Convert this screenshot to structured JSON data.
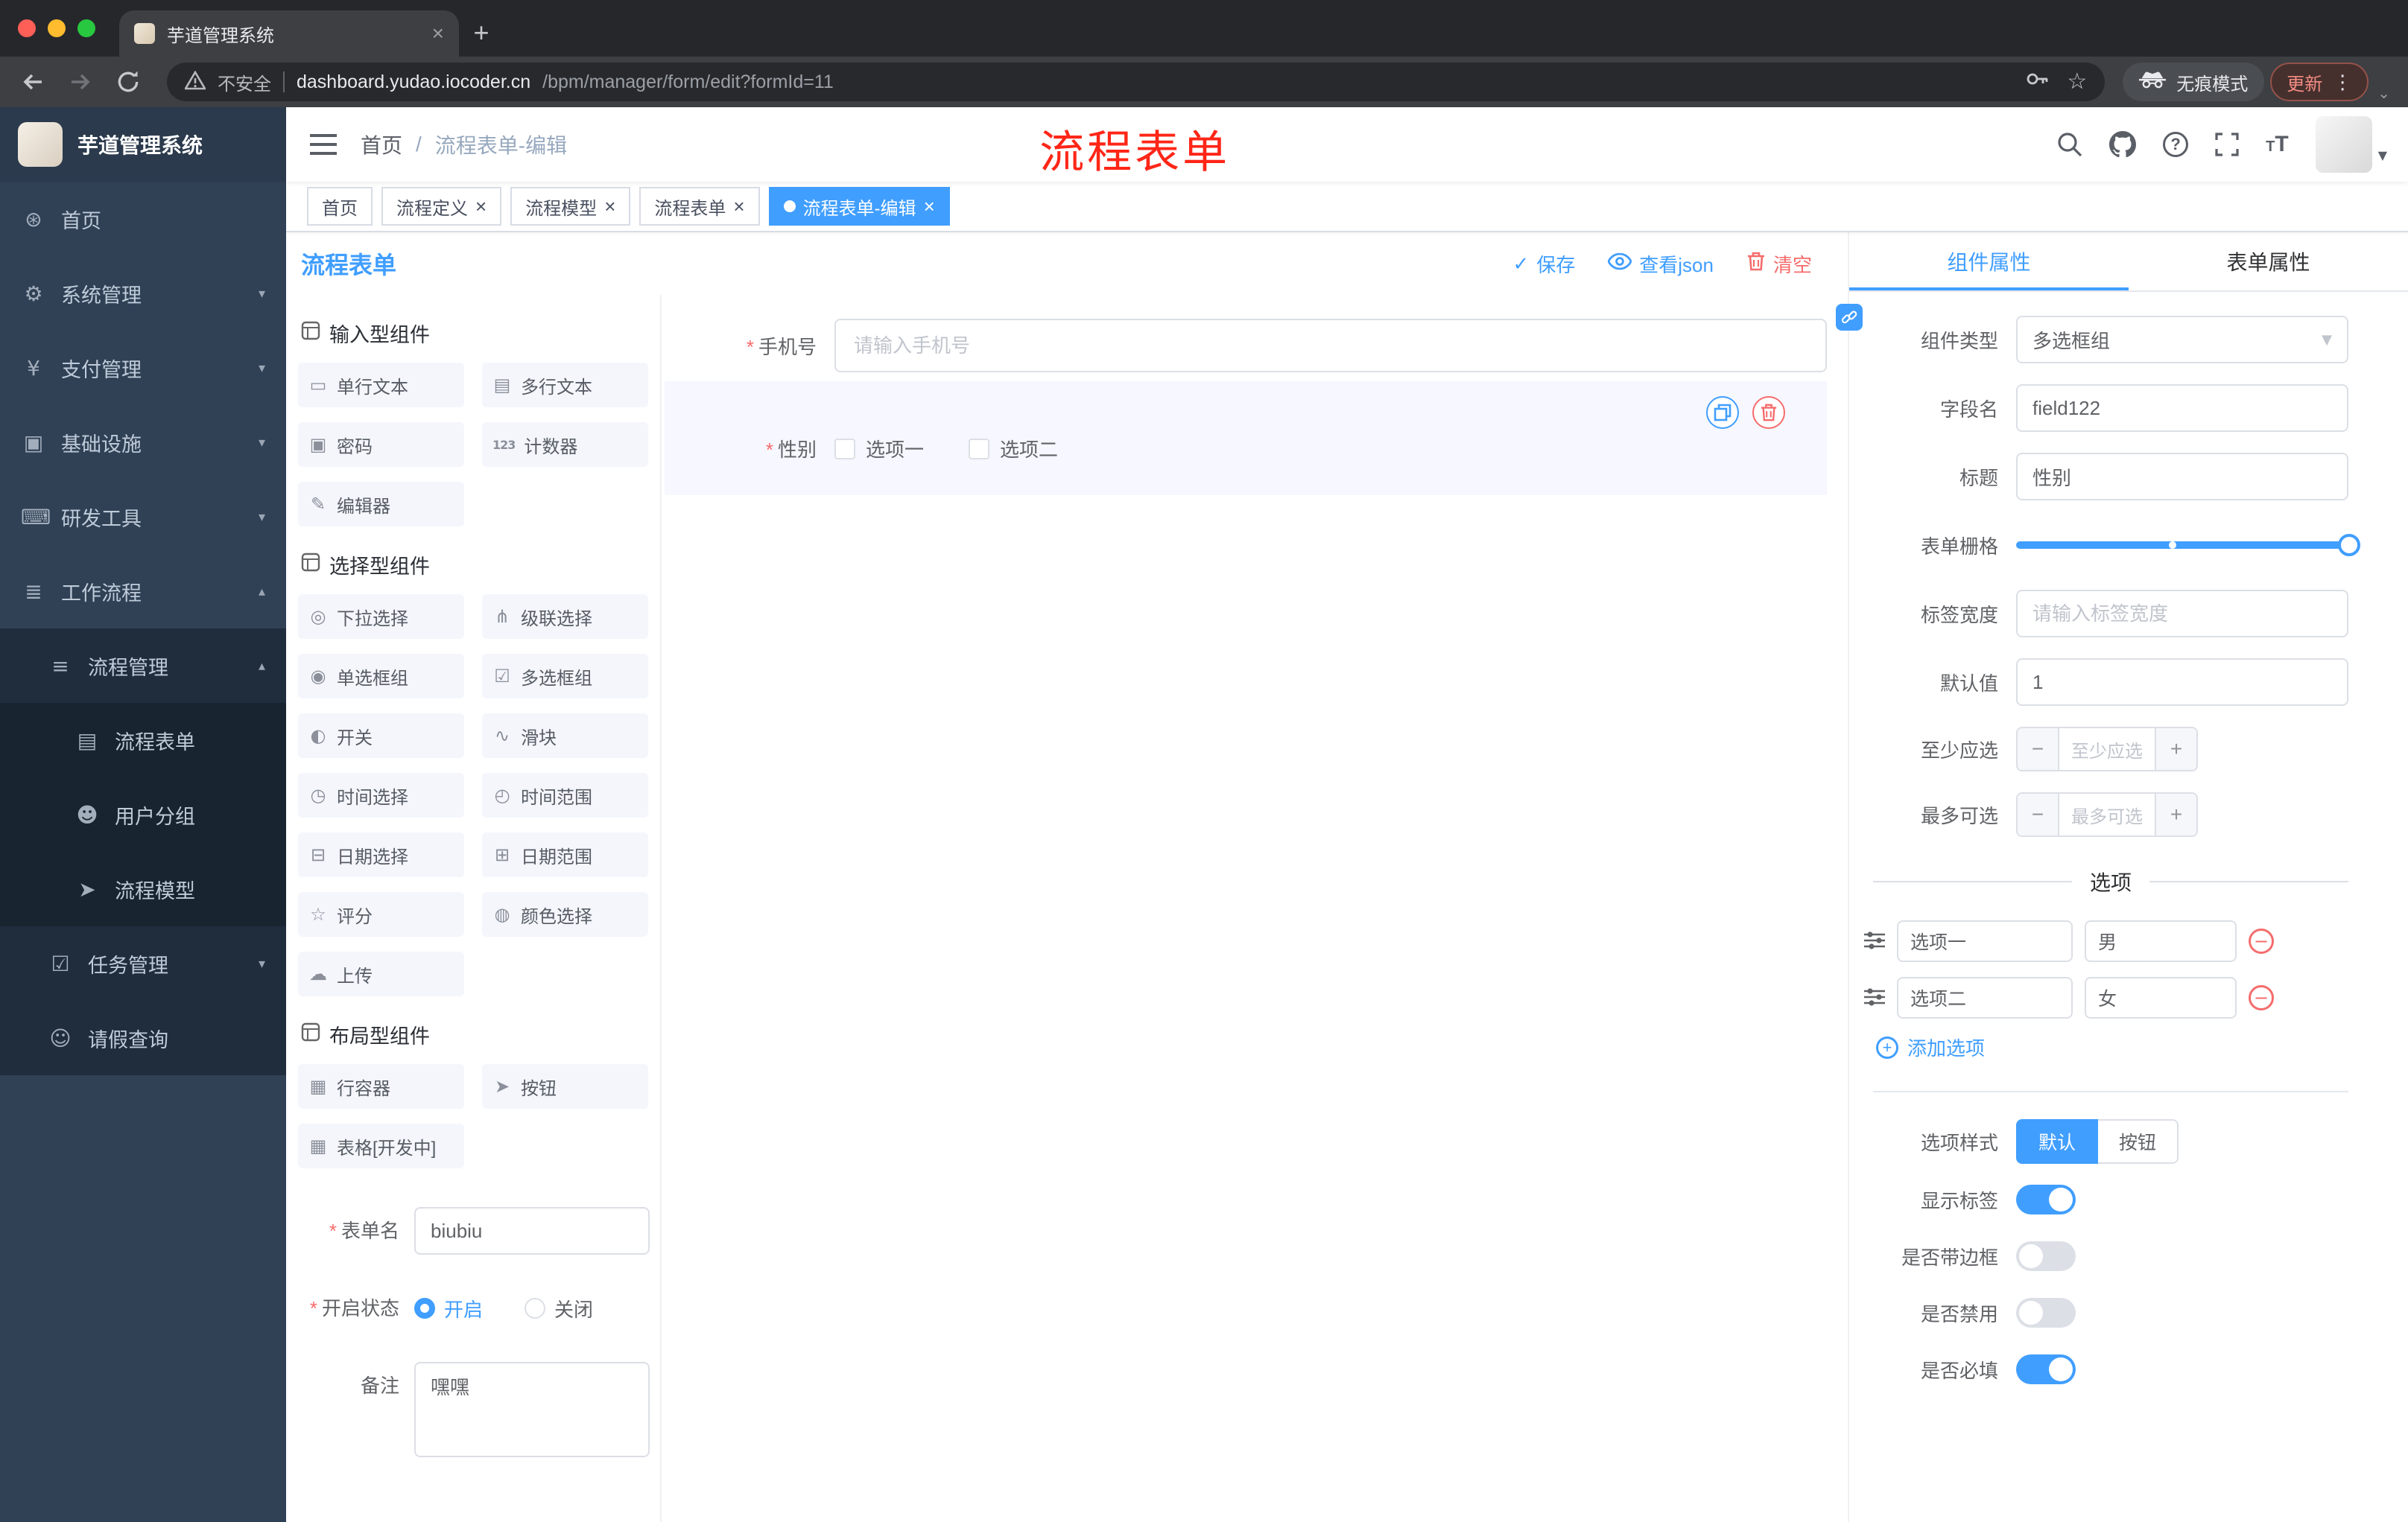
{
  "glyphs": {
    "close": "×",
    "plus": "+",
    "minus": "−",
    "kebab": "⋮",
    "chevron_down": "⌄",
    "caret_down": "▼",
    "select_caret": "▼",
    "check": "✓",
    "breadcrumb_separator": "/",
    "required_mark": "*",
    "bookmark_star": "☆"
  },
  "colors": {
    "primary": "#409eff",
    "danger": "#f56c6c",
    "annotation_red": "#ff2617",
    "sidebar_bg": "#304156",
    "active_tag_bg": "#409eff"
  },
  "browser": {
    "tab": {
      "title": "芋道管理系统"
    },
    "address": {
      "security_label": "不安全",
      "domain": "dashboard.yudao.iocoder.cn",
      "path": "/bpm/manager/form/edit?formId=11"
    },
    "incognito_label": "无痕模式",
    "update_label": "更新"
  },
  "annotation": {
    "text": "流程表单"
  },
  "sidebar": {
    "logo_title": "芋道管理系统",
    "items": [
      {
        "label": "首页",
        "icon": "home-icon",
        "glyph": "⊛"
      },
      {
        "label": "系统管理",
        "icon": "gear-icon",
        "glyph": "⚙",
        "arrow": "▾"
      },
      {
        "label": "支付管理",
        "icon": "payment-icon",
        "glyph": "¥",
        "arrow": "▾"
      },
      {
        "label": "基础设施",
        "icon": "infrastructure-icon",
        "glyph": "▣",
        "arrow": "▾"
      },
      {
        "label": "研发工具",
        "icon": "devtools-icon",
        "glyph": "⌨",
        "arrow": "▾"
      },
      {
        "label": "工作流程",
        "icon": "workflow-icon",
        "glyph": "≣",
        "arrow": "▴",
        "expanded": true
      },
      {
        "label": "流程管理",
        "icon": "process-management-icon",
        "glyph": "≡",
        "arrow": "▴",
        "expanded": true
      },
      {
        "label": "流程表单",
        "icon": "process-form-icon",
        "glyph": "▤",
        "active": true
      },
      {
        "label": "用户分组",
        "icon": "user-group-icon",
        "glyph": "☻"
      },
      {
        "label": "流程模型",
        "icon": "process-model-icon",
        "glyph": "➤"
      },
      {
        "label": "任务管理",
        "icon": "task-management-icon",
        "glyph": "☑",
        "arrow": "▾"
      },
      {
        "label": "请假查询",
        "icon": "leave-query-icon",
        "glyph": "☺"
      }
    ]
  },
  "navbar": {
    "breadcrumb": {
      "home": "首页",
      "separator": "/",
      "current": "流程表单-编辑"
    }
  },
  "tags": {
    "items": [
      {
        "label": "首页",
        "closable": false,
        "active": false
      },
      {
        "label": "流程定义",
        "closable": true,
        "active": false
      },
      {
        "label": "流程模型",
        "closable": true,
        "active": false
      },
      {
        "label": "流程表单",
        "closable": true,
        "active": false
      },
      {
        "label": "流程表单-编辑",
        "closable": true,
        "active": true
      }
    ]
  },
  "designer": {
    "title": "流程表单",
    "actions": {
      "save": "保存",
      "view_json": "查看json",
      "clear": "清空"
    }
  },
  "palette": {
    "sections": [
      {
        "title": "输入型组件",
        "items": [
          {
            "label": "单行文本",
            "icon": "single-line-text-icon",
            "glyph": "▭"
          },
          {
            "label": "多行文本",
            "icon": "multi-line-text-icon",
            "glyph": "▤"
          },
          {
            "label": "密码",
            "icon": "password-icon",
            "glyph": "▣"
          },
          {
            "label": "计数器",
            "icon": "counter-icon",
            "glyph": "123"
          },
          {
            "label": "编辑器",
            "icon": "editor-icon",
            "glyph": "✎"
          }
        ]
      },
      {
        "title": "选择型组件",
        "items": [
          {
            "label": "下拉选择",
            "icon": "select-icon",
            "glyph": "◎"
          },
          {
            "label": "级联选择",
            "icon": "cascader-icon",
            "glyph": "⋔"
          },
          {
            "label": "单选框组",
            "icon": "radio-group-icon",
            "glyph": "◉"
          },
          {
            "label": "多选框组",
            "icon": "checkbox-group-icon",
            "glyph": "☑"
          },
          {
            "label": "开关",
            "icon": "switch-icon",
            "glyph": "◐"
          },
          {
            "label": "滑块",
            "icon": "slider-icon",
            "glyph": "∿"
          },
          {
            "label": "时间选择",
            "icon": "time-picker-icon",
            "glyph": "◷"
          },
          {
            "label": "时间范围",
            "icon": "time-range-icon",
            "glyph": "◴"
          },
          {
            "label": "日期选择",
            "icon": "date-picker-icon",
            "glyph": "⊟"
          },
          {
            "label": "日期范围",
            "icon": "date-range-icon",
            "glyph": "⊞"
          },
          {
            "label": "评分",
            "icon": "rate-icon",
            "glyph": "☆"
          },
          {
            "label": "颜色选择",
            "icon": "color-picker-icon",
            "glyph": "◍"
          },
          {
            "label": "上传",
            "icon": "upload-icon",
            "glyph": "☁"
          }
        ]
      },
      {
        "title": "布局型组件",
        "items": [
          {
            "label": "行容器",
            "icon": "row-container-icon",
            "glyph": "▦"
          },
          {
            "label": "按钮",
            "icon": "button-icon",
            "glyph": "➤"
          },
          {
            "label": "表格[开发中]",
            "icon": "table-icon",
            "glyph": "▦"
          }
        ]
      }
    ]
  },
  "left_form": {
    "name": {
      "label": "表单名",
      "value": "biubiu",
      "required": true
    },
    "status": {
      "label": "开启状态",
      "on_label": "开启",
      "off_label": "关闭",
      "selected": "开启",
      "required": true
    },
    "remark": {
      "label": "备注",
      "value": "嘿嘿"
    }
  },
  "canvas": {
    "phone": {
      "label": "手机号",
      "placeholder": "请输入手机号",
      "required": true
    },
    "gender": {
      "label": "性别",
      "option1": "选项一",
      "option2": "选项二",
      "required": true,
      "selected": true
    }
  },
  "props": {
    "tabs": {
      "component": "组件属性",
      "form": "表单属性",
      "active": "组件属性"
    },
    "component_type": {
      "label": "组件类型",
      "value": "多选框组"
    },
    "field_name": {
      "label": "字段名",
      "value": "field122"
    },
    "title": {
      "label": "标题",
      "value": "性别"
    },
    "grid": {
      "label": "表单栅格",
      "value_percent": 100
    },
    "label_width": {
      "label": "标签宽度",
      "placeholder": "请输入标签宽度"
    },
    "default_value": {
      "label": "默认值",
      "value": "1"
    },
    "min_select": {
      "label": "至少应选",
      "placeholder": "至少应选"
    },
    "max_select": {
      "label": "最多可选",
      "placeholder": "最多可选"
    },
    "options_title": "选项",
    "options": [
      {
        "name": "选项一",
        "value": "男"
      },
      {
        "name": "选项二",
        "value": "女"
      }
    ],
    "add_option": "添加选项",
    "option_style": {
      "label": "选项样式",
      "default": "默认",
      "button": "按钮",
      "selected": "默认"
    },
    "toggles": [
      {
        "label": "显示标签",
        "on": true
      },
      {
        "label": "是否带边框",
        "on": false
      },
      {
        "label": "是否禁用",
        "on": false
      },
      {
        "label": "是否必填",
        "on": true
      }
    ]
  }
}
